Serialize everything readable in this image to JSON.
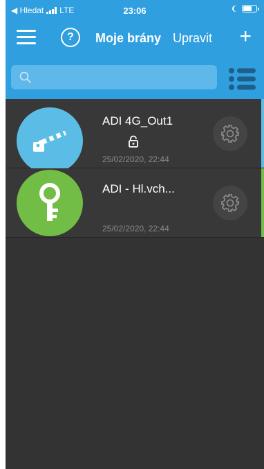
{
  "status_bar": {
    "back_label": "◀ Hledat",
    "network": "LTE",
    "time": "23:06"
  },
  "nav": {
    "title": "Moje brány",
    "edit_label": "Upravit",
    "add_label": "+",
    "help_label": "?"
  },
  "search": {
    "placeholder": ""
  },
  "gates": [
    {
      "name": "ADI 4G_Out1",
      "date": "25/02/2020, 22:44",
      "icon": "barrier-gate-icon",
      "avatar_color": "#5bbde6",
      "accent_color": "#5bbde6"
    },
    {
      "name": "ADI - Hl.vch...",
      "date": "25/02/2020, 22:44",
      "icon": "key-icon",
      "avatar_color": "#72bd45",
      "accent_color": "#72bd45"
    }
  ],
  "colors": {
    "header": "#2f9fe0",
    "background": "#333333"
  }
}
